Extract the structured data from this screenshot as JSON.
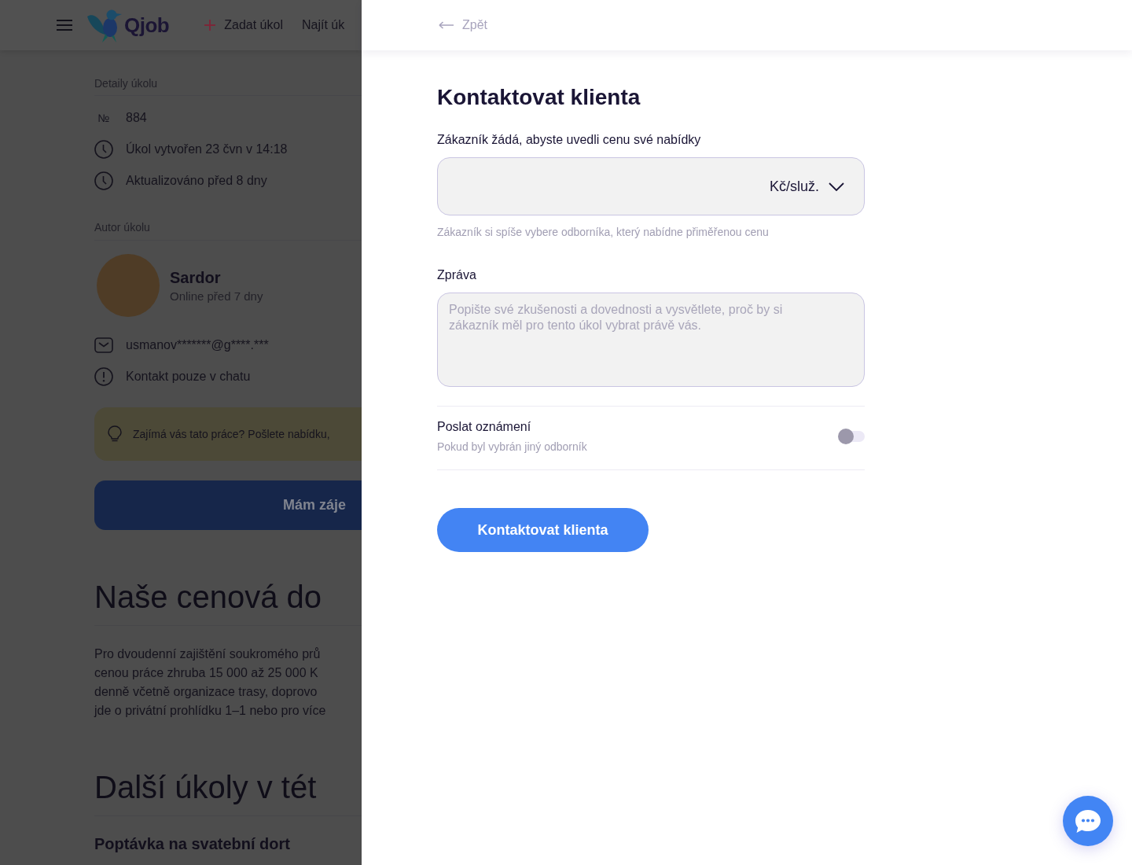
{
  "header": {
    "logo": "Qjob",
    "nav": [
      {
        "kind": "add",
        "label": "Zadat úkol"
      },
      {
        "kind": "plain",
        "label": "Najít úk"
      }
    ]
  },
  "task_details": {
    "heading": "Detaily úkolu",
    "items": [
      {
        "kind": "number",
        "marker": "№",
        "text": "884"
      },
      {
        "kind": "clock",
        "text": "Úkol vytvořen 23 čvn v 14:18"
      },
      {
        "kind": "clock",
        "text": "Aktualizováno před 8 dny"
      }
    ]
  },
  "author": {
    "heading": "Autor úkolu",
    "name": "Sardor",
    "status": "Online před 7 dny",
    "contacts": [
      {
        "kind": "email",
        "text": "usmanov*******@g****.***"
      },
      {
        "kind": "info",
        "text": "Kontakt pouze v chatu"
      }
    ]
  },
  "tip": {
    "text": "Zajímá vás tato práce? Pošlete nabídku,"
  },
  "interest_button": "Mám záje",
  "pricing": {
    "heading": "Naše cenová do",
    "lines": [
      "Pro dvoudenní zajištění soukromého prů",
      "cenou práce zhruba 15 000 až 25 000 K",
      "denně včetně organizace trasy, doprovo",
      "jde o privátní prohlídku 1–1 nebo pro více"
    ]
  },
  "more_tasks": {
    "heading": "Další úkoly v tét",
    "tasks": [
      {
        "title": "Poptávka na svatební dort"
      }
    ]
  },
  "drawer": {
    "back": "Zpět",
    "title": "Kontaktovat klienta",
    "price": {
      "label": "Zákazník žádá, abyste uvedli cenu své nabídky",
      "unit": "Kč/služ.",
      "hint": "Zákazník si spíše vybere odborníka, který nabídne přiměřenou cenu"
    },
    "message": {
      "label": "Zpráva",
      "placeholder": "Popište své zkušenosti a dovednosti a vysvětlete, proč by si zákazník měl pro tento úkol vybrat právě vás."
    },
    "notification": {
      "title": "Poslat oznámení",
      "subtitle": "Pokud byl vybrán jiný odborník",
      "on": false
    },
    "submit": "Kontaktovat klienta"
  }
}
